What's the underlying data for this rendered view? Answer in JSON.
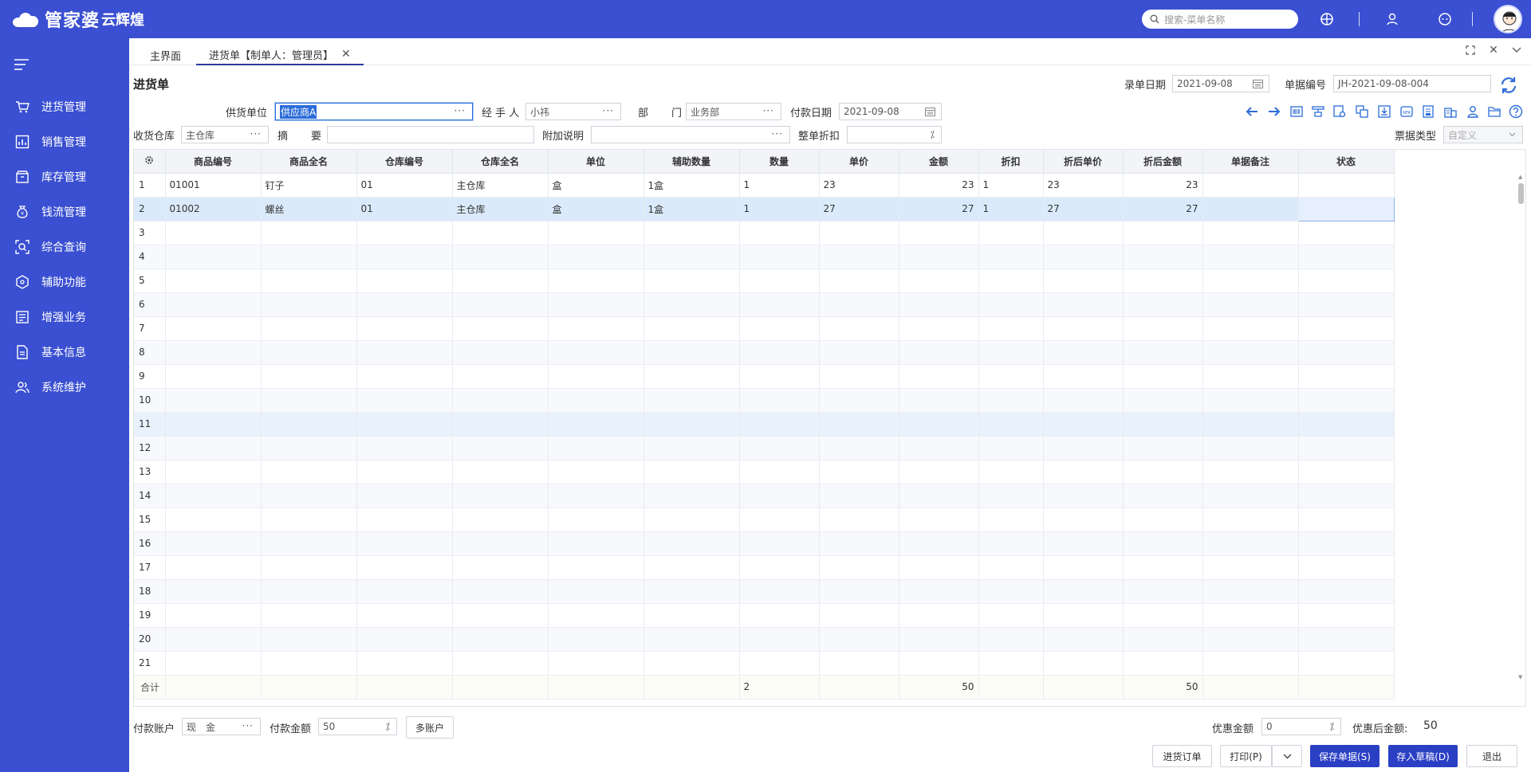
{
  "app": {
    "logo_text": "管家婆",
    "logo_sub": "云辉煌",
    "search_placeholder": "搜索-菜单名称"
  },
  "sidebar": {
    "items": [
      {
        "label": "进货管理",
        "icon": "cart-icon"
      },
      {
        "label": "销售管理",
        "icon": "chart-icon"
      },
      {
        "label": "库存管理",
        "icon": "box-icon"
      },
      {
        "label": "钱流管理",
        "icon": "moneybag-icon"
      },
      {
        "label": "综合查询",
        "icon": "query-icon"
      },
      {
        "label": "辅助功能",
        "icon": "cube-icon"
      },
      {
        "label": "增强业务",
        "icon": "list-icon"
      },
      {
        "label": "基本信息",
        "icon": "doc-icon"
      },
      {
        "label": "系统维护",
        "icon": "users-icon"
      }
    ]
  },
  "tabs": [
    {
      "label": "主界面",
      "active": false
    },
    {
      "label": "进货单【制单人：管理员】",
      "active": true
    }
  ],
  "form": {
    "title": "进货单",
    "entry_date_label": "录单日期",
    "entry_date": "2021-09-08",
    "doc_no_label": "单据编号",
    "doc_no": "JH-2021-09-08-004",
    "supplier_label": "供货单位",
    "supplier": "供应商A",
    "handler_label": "经 手 人",
    "handler": "小祎",
    "dept_label_a": "部",
    "dept_label_b": "门",
    "dept": "业务部",
    "pay_date_label": "付款日期",
    "pay_date": "2021-09-08",
    "warehouse_label": "收货仓库",
    "warehouse": "主仓库",
    "summary_label_a": "摘",
    "summary_label_b": "要",
    "summary": "",
    "note_label": "附加说明",
    "note": "",
    "discount_label": "整单折扣",
    "discount": "",
    "invoice_type_label": "票据类型",
    "invoice_type": "自定义"
  },
  "grid": {
    "columns": [
      "商品编号",
      "商品全名",
      "仓库编号",
      "仓库全名",
      "单位",
      "辅助数量",
      "数量",
      "单价",
      "金额",
      "折扣",
      "折后单价",
      "折后金额",
      "单据备注",
      "状态"
    ],
    "rows": [
      [
        "1",
        "01001",
        "钉子",
        "01",
        "主仓库",
        "盒",
        "1盒",
        "1",
        "23",
        "23",
        "1",
        "23",
        "23",
        "",
        ""
      ],
      [
        "2",
        "01002",
        "螺丝",
        "01",
        "主仓库",
        "盒",
        "1盒",
        "1",
        "27",
        "27",
        "1",
        "27",
        "27",
        "",
        ""
      ],
      [
        "3"
      ],
      [
        "4"
      ],
      [
        "5"
      ],
      [
        "6"
      ],
      [
        "7"
      ],
      [
        "8"
      ],
      [
        "9"
      ],
      [
        "10"
      ],
      [
        "11"
      ],
      [
        "12"
      ],
      [
        "13"
      ],
      [
        "14"
      ],
      [
        "15"
      ],
      [
        "16"
      ],
      [
        "17"
      ],
      [
        "18"
      ],
      [
        "19"
      ],
      [
        "20"
      ],
      [
        "21"
      ]
    ],
    "total_label": "合计",
    "total_qty": "2",
    "total_amount": "50",
    "total_disc_amount": "50"
  },
  "footer": {
    "pay_account_label": "付款账户",
    "pay_account": "现　金",
    "pay_amount_label": "付款金额",
    "pay_amount": "50",
    "multi_account": "多账户",
    "discount_amount_label": "优惠金额",
    "discount_amount": "0",
    "after_discount_label": "优惠后金额:",
    "after_discount_value": "50",
    "buttons": {
      "purchase_order": "进货订单",
      "print": "打印(P)",
      "save": "保存单据(S)",
      "draft": "存入草稿(D)",
      "exit": "退出"
    }
  },
  "colors": {
    "brand": "#3a4fd1",
    "primary_button": "#2b3fc4",
    "selected_row": "#dbeafb"
  }
}
